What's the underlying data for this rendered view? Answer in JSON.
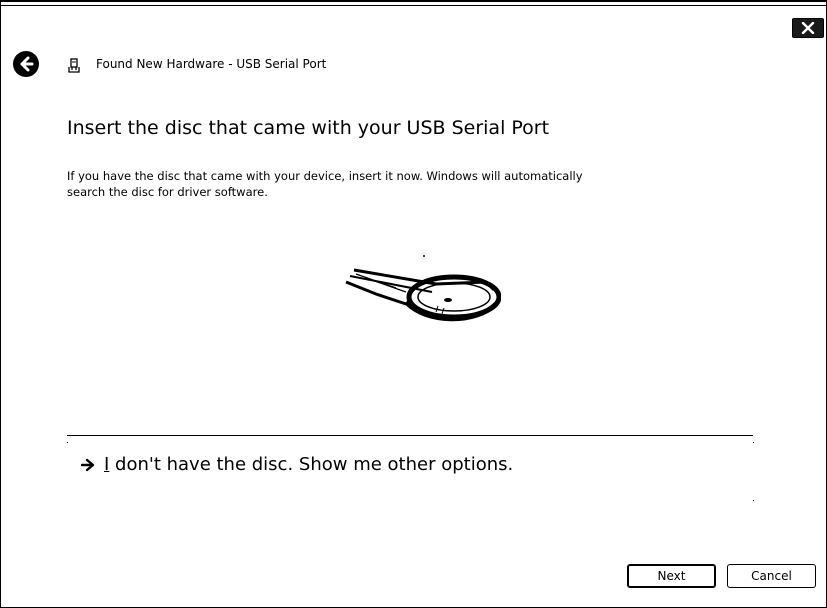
{
  "window": {
    "title": "Found New Hardware - USB Serial Port"
  },
  "content": {
    "heading": "Insert the disc that came with your USB Serial Port",
    "description_line1": "If you have the disc that came with your device, insert it now.  Windows will automatically",
    "description_line2": "search the disc for driver software."
  },
  "option": {
    "accelerator": "I",
    "label_rest": " don't have the disc.  Show me other options."
  },
  "buttons": {
    "next_label": "Next",
    "cancel_label": "Cancel"
  },
  "icons": {
    "back": "back-arrow-icon",
    "close": "close-icon",
    "hardware": "usb-hardware-icon",
    "option_arrow": "right-arrow-icon",
    "disc": "disc-drive-illustration"
  }
}
